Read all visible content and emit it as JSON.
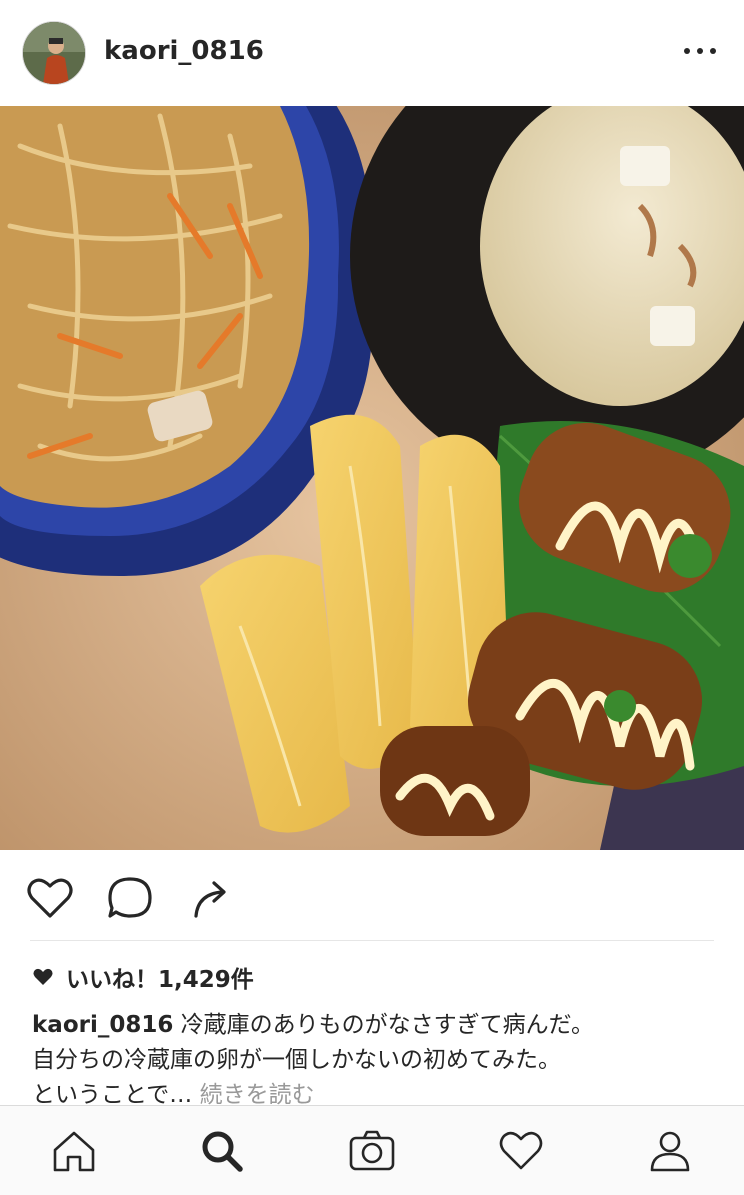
{
  "post": {
    "username": "kaori_0816",
    "likes_label": "いいね！1,429件",
    "caption_user": "kaori_0816",
    "caption_line1": "冷蔵庫のありものがなさすぎて病んだ。",
    "caption_line2": "自分ちの冷蔵庫の卵が一個しかないの初めてみた。",
    "caption_line3": "ということで…",
    "more_label": "続きを読む",
    "image_alt": "Japanese meal: kiriboshi daikon simmered dish in blue bowl, miso soup, tamagoyaki rolled omelette, teriyaki meat rolls with mayonnaise on shiso leaves"
  },
  "icons": {
    "more": "more-options-icon",
    "like": "heart-outline-icon",
    "comment": "comment-bubble-icon",
    "share": "share-arrow-icon",
    "likes_heart": "heart-filled-icon"
  },
  "nav": [
    {
      "name": "home",
      "icon": "home-icon"
    },
    {
      "name": "search",
      "icon": "search-icon"
    },
    {
      "name": "camera",
      "icon": "camera-icon"
    },
    {
      "name": "activity",
      "icon": "heart-outline-icon"
    },
    {
      "name": "profile",
      "icon": "person-icon"
    }
  ],
  "colors": {
    "text": "#262626",
    "muted": "#999999",
    "border": "#dbdbdb"
  }
}
